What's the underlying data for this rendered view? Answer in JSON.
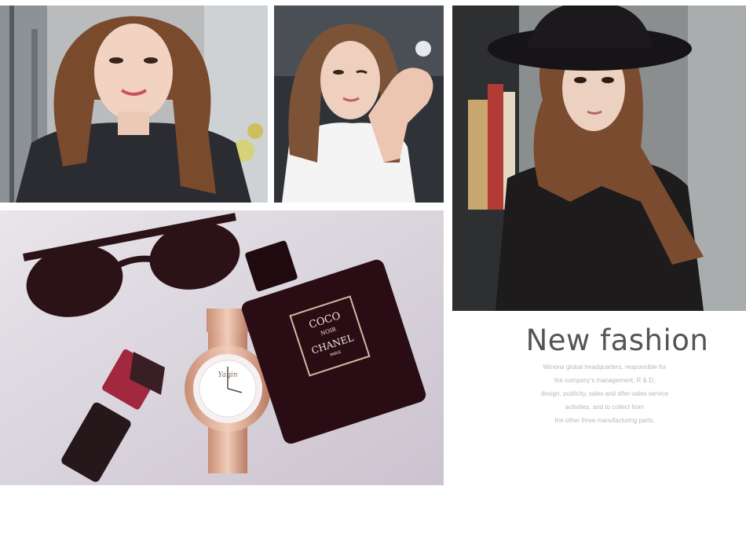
{
  "photos": [
    {
      "name": "photo-woman-gym-selfie"
    },
    {
      "name": "photo-woman-pointing"
    },
    {
      "name": "photo-woman-black-hat"
    },
    {
      "name": "photo-watch-perfume-flatlay"
    }
  ],
  "product": {
    "dial_brand": "Yaqin",
    "perfume_line1": "COCO",
    "perfume_line2": "NOIR",
    "perfume_brand": "CHANEL",
    "perfume_city": "PARIS"
  },
  "content": {
    "headline": "New fashion",
    "description_lines": [
      "Winona global headquarters, responsible for",
      "the company's management, R & D,",
      "design, publicity, sales and after-sales service",
      "activities, and to collect from",
      "the other three manufacturing parts,"
    ]
  },
  "colors": {
    "headline": "#555555",
    "description": "#b8b8b8",
    "rose_gold": "#d9a98f",
    "perfume": "#2a0d14"
  }
}
